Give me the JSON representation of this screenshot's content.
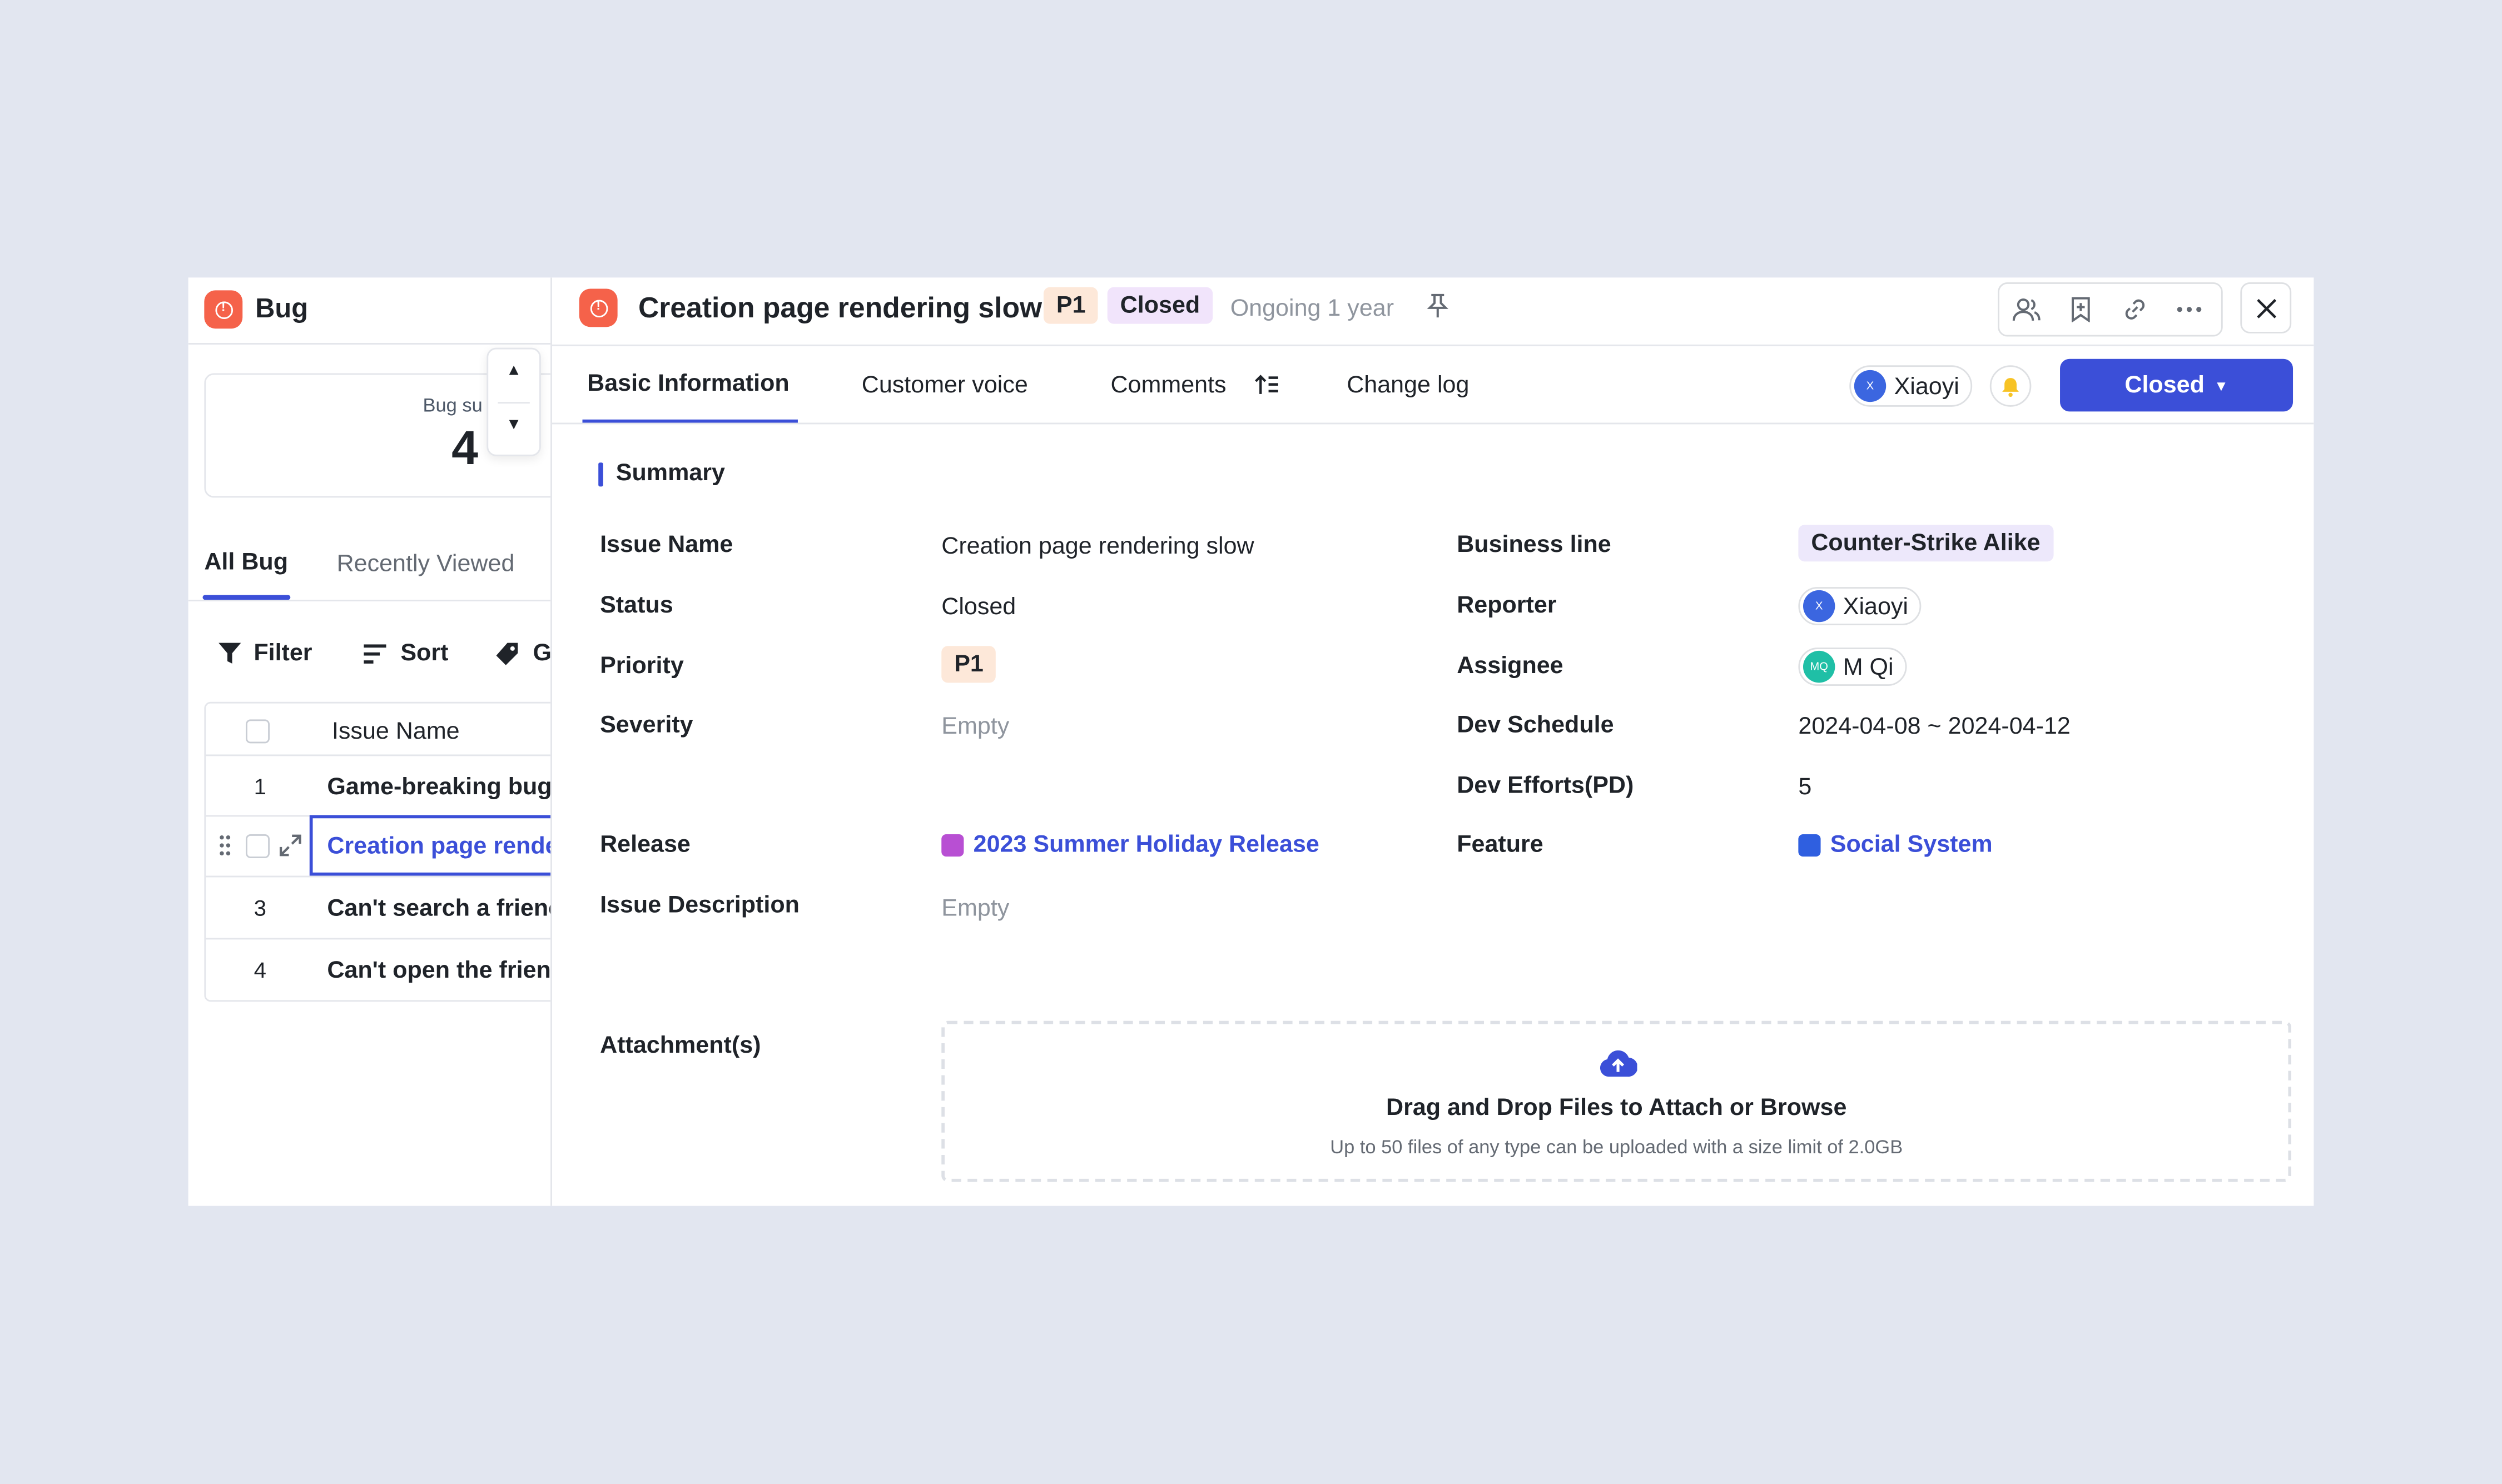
{
  "list_panel": {
    "title": "Bug",
    "card": {
      "label": "Bug su",
      "count": "4"
    },
    "tabs": [
      "All Bug",
      "Recently Viewed"
    ],
    "toolbar": {
      "filter": "Filter",
      "sort": "Sort",
      "group": "G"
    },
    "table": {
      "header": "Issue Name",
      "rows": [
        {
          "num": "1",
          "name": "Game-breaking bug"
        },
        {
          "num": "",
          "name": "Creation page rende"
        },
        {
          "num": "3",
          "name": "Can't search a frienc"
        },
        {
          "num": "4",
          "name": "Can't open the frien"
        }
      ]
    }
  },
  "detail": {
    "title": "Creation page rendering slow",
    "priority_tag": "P1",
    "status_tag": "Closed",
    "ongoing": "Ongoing 1 year",
    "tabs": [
      "Basic Information",
      "Customer voice",
      "Comments",
      "Change log"
    ],
    "owner": {
      "initial": "X",
      "name": "Xiaoyi"
    },
    "status_button": "Closed",
    "section_title": "Summary",
    "fields": {
      "issue_name": {
        "label": "Issue Name",
        "value": "Creation page rendering slow"
      },
      "status": {
        "label": "Status",
        "value": "Closed"
      },
      "priority": {
        "label": "Priority",
        "value": "P1"
      },
      "severity": {
        "label": "Severity",
        "value": "Empty"
      },
      "release": {
        "label": "Release",
        "value": "2023 Summer Holiday Release"
      },
      "issue_description": {
        "label": "Issue Description",
        "value": "Empty"
      },
      "business_line": {
        "label": "Business line",
        "value": "Counter-Strike Alike"
      },
      "reporter": {
        "label": "Reporter",
        "initial": "X",
        "value": "Xiaoyi"
      },
      "assignee": {
        "label": "Assignee",
        "initial": "MQ",
        "value": "M Qi"
      },
      "dev_schedule": {
        "label": "Dev Schedule",
        "value": "2024-04-08 ~ 2024-04-12"
      },
      "dev_efforts": {
        "label": "Dev Efforts(PD)",
        "value": "5"
      },
      "feature": {
        "label": "Feature",
        "value": "Social System"
      }
    },
    "attachments": {
      "label": "Attachment(s)",
      "title": "Drag and Drop Files to Attach or Browse",
      "hint": "Up to 50 files of any type can be uploaded with a size limit of 2.0GB"
    }
  },
  "colors": {
    "accent": "#3b4fd8",
    "bug_icon": "#f5624a",
    "priority_bg": "#fde8d9",
    "status_bg": "#f1e4fb",
    "business_bg": "#ede8fb",
    "release_square": "#b84fd3",
    "feature_square": "#2f5fe0",
    "bell": "#f7c325"
  }
}
